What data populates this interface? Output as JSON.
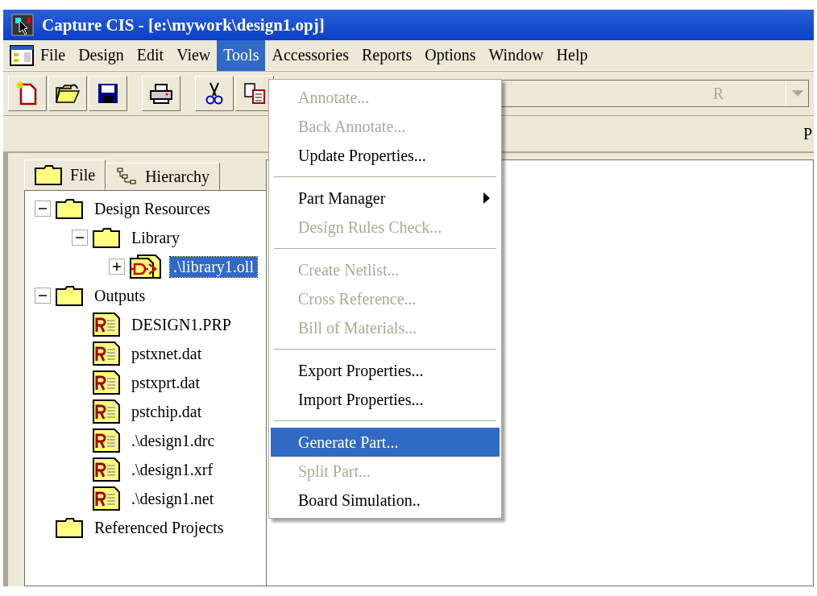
{
  "window": {
    "title": "Capture CIS - [e:\\mywork\\design1.opj]"
  },
  "menu_bar": [
    {
      "label": "File",
      "selected": false
    },
    {
      "label": "Design",
      "selected": false
    },
    {
      "label": "Edit",
      "selected": false
    },
    {
      "label": "View",
      "selected": false
    },
    {
      "label": "Tools",
      "selected": true
    },
    {
      "label": "Accessories",
      "selected": false
    },
    {
      "label": "Reports",
      "selected": false
    },
    {
      "label": "Options",
      "selected": false
    },
    {
      "label": "Window",
      "selected": false
    },
    {
      "label": "Help",
      "selected": false
    }
  ],
  "toolbar": [
    {
      "kind": "new"
    },
    {
      "kind": "open"
    },
    {
      "kind": "save"
    },
    {
      "kind": "print"
    },
    {
      "kind": "cut"
    },
    {
      "kind": "copy"
    }
  ],
  "combo": {
    "value": "R"
  },
  "strip": {
    "text": "P"
  },
  "tabs": [
    {
      "label": "File",
      "kind": "folder",
      "selected": true
    },
    {
      "label": "Hierarchy",
      "kind": "hierarchy",
      "selected": false
    }
  ],
  "tree": [
    {
      "label": "Design Resources",
      "kind": "folder",
      "expanded": true,
      "selected": false,
      "children": [
        {
          "label": "Library",
          "kind": "folder",
          "expanded": true,
          "selected": false,
          "children": [
            {
              "label": ".\\library1.oll",
              "kind": "library",
              "expanded": false,
              "selected": true
            }
          ]
        }
      ]
    },
    {
      "label": "Outputs",
      "kind": "folder",
      "expanded": true,
      "selected": false,
      "children": [
        {
          "label": "DESIGN1.PRP",
          "kind": "report",
          "selected": false
        },
        {
          "label": "pstxnet.dat",
          "kind": "report",
          "selected": false
        },
        {
          "label": "pstxprt.dat",
          "kind": "report",
          "selected": false
        },
        {
          "label": "pstchip.dat",
          "kind": "report",
          "selected": false
        },
        {
          "label": ".\\design1.drc",
          "kind": "report",
          "selected": false
        },
        {
          "label": ".\\design1.xrf",
          "kind": "report",
          "selected": false
        },
        {
          "label": ".\\design1.net",
          "kind": "report",
          "selected": false
        }
      ]
    },
    {
      "label": "Referenced Projects",
      "kind": "folder",
      "selected": false
    }
  ],
  "tools_menu": [
    {
      "kind": "item",
      "label": "Annotate...",
      "disabled": true,
      "selected": false
    },
    {
      "kind": "item",
      "label": "Back Annotate...",
      "disabled": true,
      "selected": false
    },
    {
      "kind": "item",
      "label": "Update Properties...",
      "disabled": false,
      "selected": false
    },
    {
      "kind": "separator"
    },
    {
      "kind": "submenu",
      "label": "Part Manager",
      "disabled": false,
      "selected": false
    },
    {
      "kind": "item",
      "label": "Design Rules Check...",
      "disabled": true,
      "selected": false
    },
    {
      "kind": "separator"
    },
    {
      "kind": "item",
      "label": "Create Netlist...",
      "disabled": true,
      "selected": false
    },
    {
      "kind": "item",
      "label": "Cross Reference...",
      "disabled": true,
      "selected": false
    },
    {
      "kind": "item",
      "label": "Bill of Materials...",
      "disabled": true,
      "selected": false
    },
    {
      "kind": "separator"
    },
    {
      "kind": "item",
      "label": "Export Properties...",
      "disabled": false,
      "selected": false
    },
    {
      "kind": "item",
      "label": "Import Properties...",
      "disabled": false,
      "selected": false
    },
    {
      "kind": "separator"
    },
    {
      "kind": "item",
      "label": "Generate Part...",
      "disabled": false,
      "selected": true
    },
    {
      "kind": "item",
      "label": "Split Part...",
      "disabled": true,
      "selected": false
    },
    {
      "kind": "item",
      "label": "Board Simulation..",
      "disabled": false,
      "selected": false
    }
  ]
}
